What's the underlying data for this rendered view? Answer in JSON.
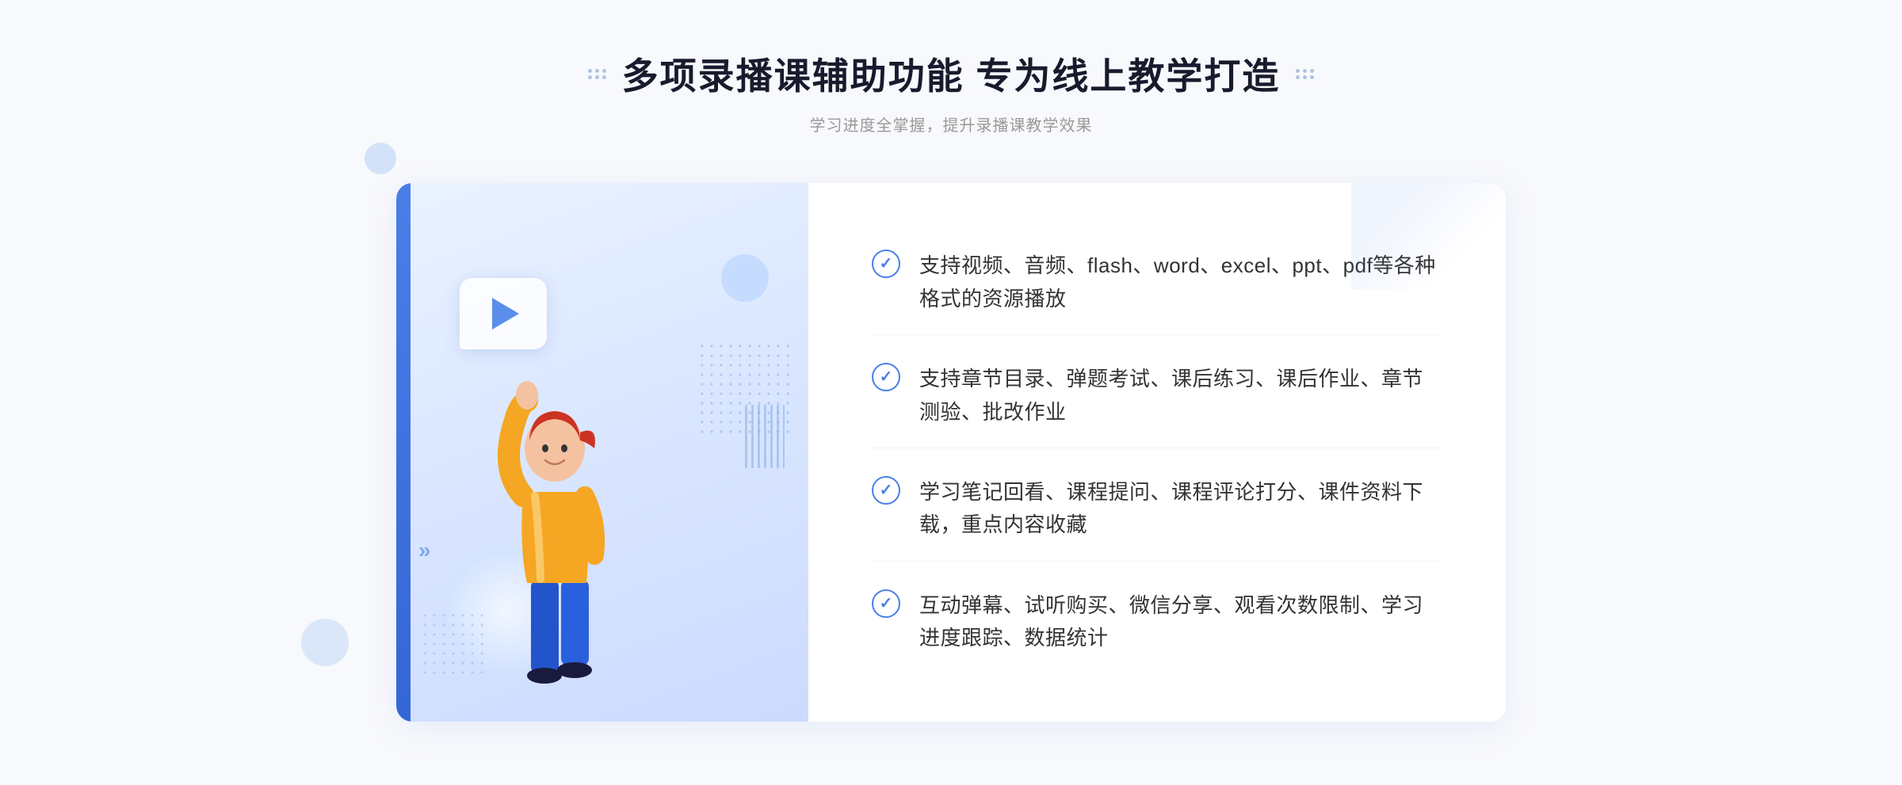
{
  "header": {
    "title": "多项录播课辅助功能 专为线上教学打造",
    "subtitle": "学习进度全掌握，提升录播课教学效果"
  },
  "features": [
    {
      "id": "feature-1",
      "text": "支持视频、音频、flash、word、excel、ppt、pdf等各种格式的资源播放"
    },
    {
      "id": "feature-2",
      "text": "支持章节目录、弹题考试、课后练习、课后作业、章节测验、批改作业"
    },
    {
      "id": "feature-3",
      "text": "学习笔记回看、课程提问、课程评论打分、课件资料下载，重点内容收藏"
    },
    {
      "id": "feature-4",
      "text": "互动弹幕、试听购买、微信分享、观看次数限制、学习进度跟踪、数据统计"
    }
  ]
}
